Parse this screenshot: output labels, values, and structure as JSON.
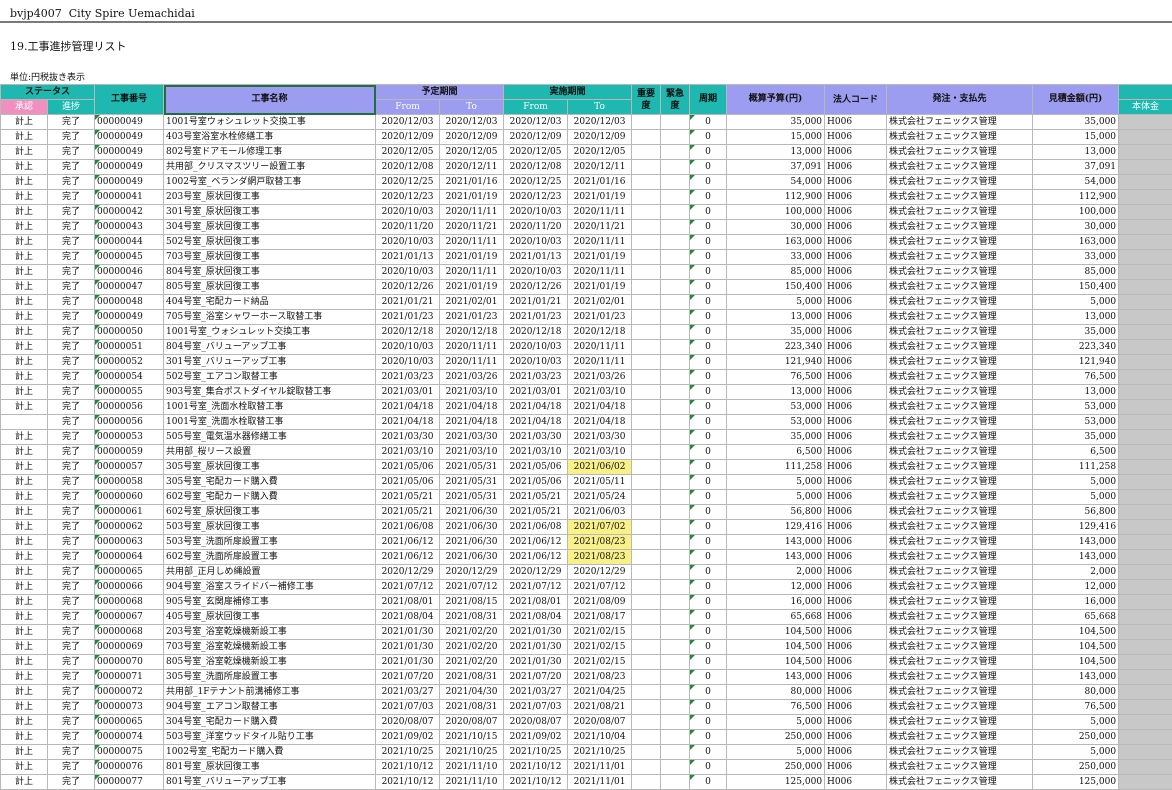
{
  "header": {
    "file_code": "bvjp4007",
    "property": "City Spire Uemachidai",
    "title": "19.工事進捗管理リスト",
    "unit_note": "単位:円税抜き表示"
  },
  "columns": {
    "status_group": "ステータス",
    "approve": "承認",
    "progress": "進捗",
    "work_no": "工事番号",
    "work_name": "工事名称",
    "plan_period": "予定期間",
    "actual_period": "実施期間",
    "from": "From",
    "to": "To",
    "importance": "重要度",
    "urgency": "緊急度",
    "cycle": "周期",
    "budget": "概算予算(円)",
    "corp_code": "法人コード",
    "vendor": "発注・支払先",
    "estimate": "見積金額(円)",
    "main_amount": "本体金"
  },
  "rows": [
    [
      "計上",
      "完了",
      "00000049",
      "1001号室ウォシュレット交換工事",
      "2020/12/03",
      "2020/12/03",
      "2020/12/03",
      "2020/12/03",
      "0",
      "35,000",
      "H006",
      "株式会社フェニックス管理",
      "35,000"
    ],
    [
      "計上",
      "完了",
      "00000049",
      "403号室浴室水栓修繕工事",
      "2020/12/09",
      "2020/12/09",
      "2020/12/09",
      "2020/12/09",
      "0",
      "15,000",
      "H006",
      "株式会社フェニックス管理",
      "15,000"
    ],
    [
      "計上",
      "完了",
      "00000049",
      "802号室ドアモール修理工事",
      "2020/12/05",
      "2020/12/05",
      "2020/12/05",
      "2020/12/05",
      "0",
      "13,000",
      "H006",
      "株式会社フェニックス管理",
      "13,000"
    ],
    [
      "計上",
      "完了",
      "00000049",
      "共用部_クリスマスツリー設置工事",
      "2020/12/08",
      "2020/12/11",
      "2020/12/08",
      "2020/12/11",
      "0",
      "37,091",
      "H006",
      "株式会社フェニックス管理",
      "37,091"
    ],
    [
      "計上",
      "完了",
      "00000049",
      "1002号室_ベランダ網戸取替工事",
      "2020/12/25",
      "2021/01/16",
      "2020/12/25",
      "2021/01/16",
      "0",
      "54,000",
      "H006",
      "株式会社フェニックス管理",
      "54,000"
    ],
    [
      "計上",
      "完了",
      "00000041",
      "203号室_原状回復工事",
      "2020/12/23",
      "2021/01/19",
      "2020/12/23",
      "2021/01/19",
      "0",
      "112,900",
      "H006",
      "株式会社フェニックス管理",
      "112,900"
    ],
    [
      "計上",
      "完了",
      "00000042",
      "301号室_原状回復工事",
      "2020/10/03",
      "2020/11/11",
      "2020/10/03",
      "2020/11/11",
      "0",
      "100,000",
      "H006",
      "株式会社フェニックス管理",
      "100,000"
    ],
    [
      "計上",
      "完了",
      "00000043",
      "304号室_原状回復工事",
      "2020/11/20",
      "2020/11/21",
      "2020/11/20",
      "2020/11/21",
      "0",
      "30,000",
      "H006",
      "株式会社フェニックス管理",
      "30,000"
    ],
    [
      "計上",
      "完了",
      "00000044",
      "502号室_原状回復工事",
      "2020/10/03",
      "2020/11/11",
      "2020/10/03",
      "2020/11/11",
      "0",
      "163,000",
      "H006",
      "株式会社フェニックス管理",
      "163,000"
    ],
    [
      "計上",
      "完了",
      "00000045",
      "703号室_原状回復工事",
      "2021/01/13",
      "2021/01/19",
      "2021/01/13",
      "2021/01/19",
      "0",
      "33,000",
      "H006",
      "株式会社フェニックス管理",
      "33,000"
    ],
    [
      "計上",
      "完了",
      "00000046",
      "804号室_原状回復工事",
      "2020/10/03",
      "2020/11/11",
      "2020/10/03",
      "2020/11/11",
      "0",
      "85,000",
      "H006",
      "株式会社フェニックス管理",
      "85,000"
    ],
    [
      "計上",
      "完了",
      "00000047",
      "805号室_原状回復工事",
      "2020/12/26",
      "2021/01/19",
      "2020/12/26",
      "2021/01/19",
      "0",
      "150,400",
      "H006",
      "株式会社フェニックス管理",
      "150,400"
    ],
    [
      "計上",
      "完了",
      "00000048",
      "404号室_宅配カード納品",
      "2021/01/21",
      "2021/02/01",
      "2021/01/21",
      "2021/02/01",
      "0",
      "5,000",
      "H006",
      "株式会社フェニックス管理",
      "5,000"
    ],
    [
      "計上",
      "完了",
      "00000049",
      "705号室_浴室シャワーホース取替工事",
      "2021/01/23",
      "2021/01/23",
      "2021/01/23",
      "2021/01/23",
      "0",
      "13,000",
      "H006",
      "株式会社フェニックス管理",
      "13,000"
    ],
    [
      "計上",
      "完了",
      "00000050",
      "1001号室_ウォシュレット交換工事",
      "2020/12/18",
      "2020/12/18",
      "2020/12/18",
      "2020/12/18",
      "0",
      "35,000",
      "H006",
      "株式会社フェニックス管理",
      "35,000"
    ],
    [
      "計上",
      "完了",
      "00000051",
      "804号室_バリューアップ工事",
      "2020/10/03",
      "2020/11/11",
      "2020/10/03",
      "2020/11/11",
      "0",
      "223,340",
      "H006",
      "株式会社フェニックス管理",
      "223,340"
    ],
    [
      "計上",
      "完了",
      "00000052",
      "301号室_バリューアップ工事",
      "2020/10/03",
      "2020/11/11",
      "2020/10/03",
      "2020/11/11",
      "0",
      "121,940",
      "H006",
      "株式会社フェニックス管理",
      "121,940"
    ],
    [
      "計上",
      "完了",
      "00000054",
      "502号室_エアコン取替工事",
      "2021/03/23",
      "2021/03/26",
      "2021/03/23",
      "2021/03/26",
      "0",
      "76,500",
      "H006",
      "株式会社フェニックス管理",
      "76,500"
    ],
    [
      "計上",
      "完了",
      "00000055",
      "903号室_集合ポストダイヤル錠取替工事",
      "2021/03/01",
      "2021/03/10",
      "2021/03/01",
      "2021/03/10",
      "0",
      "13,000",
      "H006",
      "株式会社フェニックス管理",
      "13,000"
    ],
    [
      "計上",
      "完了",
      "00000056",
      "1001号室_洗面水栓取替工事",
      "2021/04/18",
      "2021/04/18",
      "2021/04/18",
      "2021/04/18",
      "0",
      "53,000",
      "H006",
      "株式会社フェニックス管理",
      "53,000"
    ],
    [
      "",
      "完了",
      "00000056",
      "1001号室_洗面水栓取替工事",
      "2021/04/18",
      "2021/04/18",
      "2021/04/18",
      "2021/04/18",
      "0",
      "53,000",
      "H006",
      "株式会社フェニックス管理",
      "53,000"
    ],
    [
      "計上",
      "完了",
      "00000053",
      "505号室_電気温水器修繕工事",
      "2021/03/30",
      "2021/03/30",
      "2021/03/30",
      "2021/03/30",
      "0",
      "35,000",
      "H006",
      "株式会社フェニックス管理",
      "35,000"
    ],
    [
      "計上",
      "完了",
      "00000059",
      "共用部_桜リース設置",
      "2021/03/10",
      "2021/03/10",
      "2021/03/10",
      "2021/03/10",
      "0",
      "6,500",
      "H006",
      "株式会社フェニックス管理",
      "6,500"
    ],
    [
      "計上",
      "完了",
      "00000057",
      "305号室_原状回復工事",
      "2021/05/06",
      "2021/05/31",
      "2021/05/06",
      "2021/06/02",
      "0",
      "111,258",
      "H006",
      "株式会社フェニックス管理",
      "111,258"
    ],
    [
      "計上",
      "完了",
      "00000058",
      "305号室_宅配カード購入費",
      "2021/05/06",
      "2021/05/31",
      "2021/05/06",
      "2021/05/11",
      "0",
      "5,000",
      "H006",
      "株式会社フェニックス管理",
      "5,000"
    ],
    [
      "計上",
      "完了",
      "00000060",
      "602号室_宅配カード購入費",
      "2021/05/21",
      "2021/05/31",
      "2021/05/21",
      "2021/05/24",
      "0",
      "5,000",
      "H006",
      "株式会社フェニックス管理",
      "5,000"
    ],
    [
      "計上",
      "完了",
      "00000061",
      "602号室_原状回復工事",
      "2021/05/21",
      "2021/06/30",
      "2021/05/21",
      "2021/06/03",
      "0",
      "56,800",
      "H006",
      "株式会社フェニックス管理",
      "56,800"
    ],
    [
      "計上",
      "完了",
      "00000062",
      "503号室_原状回復工事",
      "2021/06/08",
      "2021/06/30",
      "2021/06/08",
      "2021/07/02",
      "0",
      "129,416",
      "H006",
      "株式会社フェニックス管理",
      "129,416"
    ],
    [
      "計上",
      "完了",
      "00000063",
      "503号室_洗面所扉設置工事",
      "2021/06/12",
      "2021/06/30",
      "2021/06/12",
      "2021/08/23",
      "0",
      "143,000",
      "H006",
      "株式会社フェニックス管理",
      "143,000"
    ],
    [
      "計上",
      "完了",
      "00000064",
      "602号室_洗面所扉設置工事",
      "2021/06/12",
      "2021/06/30",
      "2021/06/12",
      "2021/08/23",
      "0",
      "143,000",
      "H006",
      "株式会社フェニックス管理",
      "143,000"
    ],
    [
      "計上",
      "完了",
      "00000065",
      "共用部_正月しめ縄設置",
      "2020/12/29",
      "2020/12/29",
      "2020/12/29",
      "2020/12/29",
      "0",
      "2,000",
      "H006",
      "株式会社フェニックス管理",
      "2,000"
    ],
    [
      "計上",
      "完了",
      "00000066",
      "904号室_浴室スライドバー補修工事",
      "2021/07/12",
      "2021/07/12",
      "2021/07/12",
      "2021/07/12",
      "0",
      "12,000",
      "H006",
      "株式会社フェニックス管理",
      "12,000"
    ],
    [
      "計上",
      "完了",
      "00000068",
      "905号室_玄関扉補修工事",
      "2021/08/01",
      "2021/08/15",
      "2021/08/01",
      "2021/08/09",
      "0",
      "16,000",
      "H006",
      "株式会社フェニックス管理",
      "16,000"
    ],
    [
      "計上",
      "完了",
      "00000067",
      "405号室_原状回復工事",
      "2021/08/04",
      "2021/08/31",
      "2021/08/04",
      "2021/08/17",
      "0",
      "65,668",
      "H006",
      "株式会社フェニックス管理",
      "65,668"
    ],
    [
      "計上",
      "完了",
      "00000068",
      "203号室_浴室乾燥機新設工事",
      "2021/01/30",
      "2021/02/20",
      "2021/01/30",
      "2021/02/15",
      "0",
      "104,500",
      "H006",
      "株式会社フェニックス管理",
      "104,500"
    ],
    [
      "計上",
      "完了",
      "00000069",
      "703号室_浴室乾燥機新設工事",
      "2021/01/30",
      "2021/02/20",
      "2021/01/30",
      "2021/02/15",
      "0",
      "104,500",
      "H006",
      "株式会社フェニックス管理",
      "104,500"
    ],
    [
      "計上",
      "完了",
      "00000070",
      "805号室_浴室乾燥機新設工事",
      "2021/01/30",
      "2021/02/20",
      "2021/01/30",
      "2021/02/15",
      "0",
      "104,500",
      "H006",
      "株式会社フェニックス管理",
      "104,500"
    ],
    [
      "計上",
      "完了",
      "00000071",
      "305号室_洗面所扉設置工事",
      "2021/07/20",
      "2021/08/31",
      "2021/07/20",
      "2021/08/23",
      "0",
      "143,000",
      "H006",
      "株式会社フェニックス管理",
      "143,000"
    ],
    [
      "計上",
      "完了",
      "00000072",
      "共用部_1Fテナント前溝補修工事",
      "2021/03/27",
      "2021/04/30",
      "2021/03/27",
      "2021/04/25",
      "0",
      "80,000",
      "H006",
      "株式会社フェニックス管理",
      "80,000"
    ],
    [
      "計上",
      "完了",
      "00000073",
      "904号室_エアコン取替工事",
      "2021/07/03",
      "2021/08/31",
      "2021/07/03",
      "2021/08/21",
      "0",
      "76,500",
      "H006",
      "株式会社フェニックス管理",
      "76,500"
    ],
    [
      "計上",
      "完了",
      "00000065",
      "304号室_宅配カード購入費",
      "2020/08/07",
      "2020/08/07",
      "2020/08/07",
      "2020/08/07",
      "0",
      "5,000",
      "H006",
      "株式会社フェニックス管理",
      "5,000"
    ],
    [
      "計上",
      "完了",
      "00000074",
      "503号室_洋室ウッドタイル貼り工事",
      "2021/09/02",
      "2021/10/15",
      "2021/09/02",
      "2021/10/04",
      "0",
      "250,000",
      "H006",
      "株式会社フェニックス管理",
      "250,000"
    ],
    [
      "計上",
      "完了",
      "00000075",
      "1002号室_宅配カード購入費",
      "2021/10/25",
      "2021/10/25",
      "2021/10/25",
      "2021/10/25",
      "0",
      "5,000",
      "H006",
      "株式会社フェニックス管理",
      "5,000"
    ],
    [
      "計上",
      "完了",
      "00000076",
      "801号室_原状回復工事",
      "2021/10/12",
      "2021/11/10",
      "2021/10/12",
      "2021/11/01",
      "0",
      "250,000",
      "H006",
      "株式会社フェニックス管理",
      "250,000"
    ],
    [
      "計上",
      "完了",
      "00000077",
      "801号室_バリューアップ工事",
      "2021/10/12",
      "2021/11/10",
      "2021/10/12",
      "2021/11/01",
      "0",
      "125,000",
      "H006",
      "株式会社フェニックス管理",
      "125,000"
    ]
  ],
  "highlighted_rows": [
    23,
    27,
    28,
    29
  ]
}
